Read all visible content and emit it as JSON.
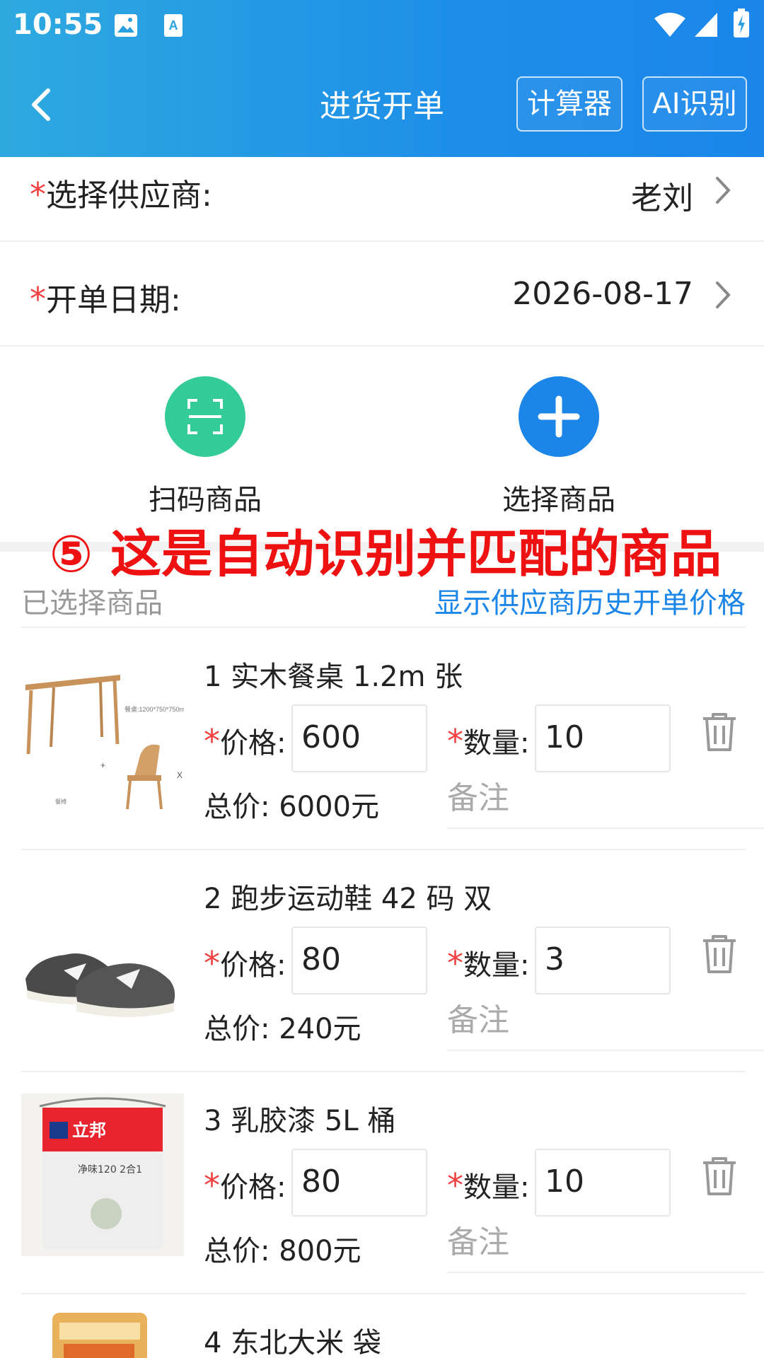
{
  "status_bar": {
    "time": "10:55"
  },
  "header": {
    "title": "进货开单",
    "calculator_label": "计算器",
    "ai_label": "AI识别",
    "background_color": "#1e8ee8"
  },
  "form": {
    "required_mark": "*",
    "supplier_label": "选择供应商:",
    "supplier_value": "老刘",
    "date_label": "开单日期:",
    "date_value": "2026-08-17"
  },
  "actions": {
    "scan_label": "扫码商品",
    "scan_color": "#33cc99",
    "select_label": "选择商品",
    "select_color": "#1c86e8"
  },
  "annotation": "⑤ 这是自动识别并匹配的商品",
  "section": {
    "title": "已选择商品",
    "history_link": "显示供应商历史开单价格"
  },
  "labels": {
    "price": "价格:",
    "qty": "数量:",
    "total_prefix": "总价:",
    "note_placeholder": "备注"
  },
  "items": [
    {
      "name": "1 实木餐桌 1.2m 张",
      "price": "600",
      "qty": "10",
      "total": "6000元",
      "image": "dining-table-icon"
    },
    {
      "name": "2 跑步运动鞋 42 码 双",
      "price": "80",
      "qty": "3",
      "total": "240元",
      "image": "running-shoes-icon"
    },
    {
      "name": "3 乳胶漆 5L 桶",
      "price": "80",
      "qty": "10",
      "total": "800元",
      "image": "paint-bucket-icon"
    },
    {
      "name": "4 东北大米 袋",
      "image": "rice-bag-icon"
    }
  ]
}
